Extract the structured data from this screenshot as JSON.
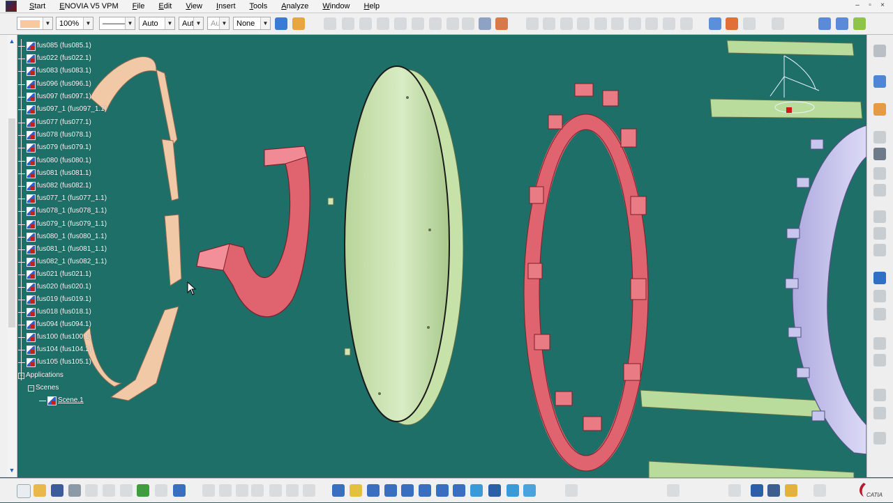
{
  "menubar": {
    "items": [
      {
        "key": "start",
        "label": "Start"
      },
      {
        "key": "enovia",
        "label": "ENOVIA V5 VPM"
      },
      {
        "key": "file",
        "label": "File"
      },
      {
        "key": "edit",
        "label": "Edit"
      },
      {
        "key": "view",
        "label": "View"
      },
      {
        "key": "insert",
        "label": "Insert"
      },
      {
        "key": "tools",
        "label": "Tools"
      },
      {
        "key": "analyze",
        "label": "Analyze"
      },
      {
        "key": "window",
        "label": "Window"
      },
      {
        "key": "help",
        "label": "Help"
      }
    ],
    "window_controls": {
      "minimize": "–",
      "restore": "▫",
      "close": "×"
    }
  },
  "toolbar": {
    "fill_color_combo": "",
    "transparency_combo": "100%",
    "line_type_combo": "———",
    "line_thickness_combo": "Auto",
    "point_symbol_combo": "Aut",
    "layer_combo_disabled": "Aut",
    "layer_combo": "None"
  },
  "tree": {
    "nodes": [
      "fus085 (fus085.1)",
      "fus022 (fus022.1)",
      "fus083 (fus083.1)",
      "fus096 (fus096.1)",
      "fus097 (fus097.1)",
      "fus097_1 (fus097_1.1)",
      "fus077 (fus077.1)",
      "fus078 (fus078.1)",
      "fus079 (fus079.1)",
      "fus080 (fus080.1)",
      "fus081 (fus081.1)",
      "fus082 (fus082.1)",
      "fus077_1 (fus077_1.1)",
      "fus078_1 (fus078_1.1)",
      "fus079_1 (fus079_1.1)",
      "fus080_1 (fus080_1.1)",
      "fus081_1 (fus081_1.1)",
      "fus082_1 (fus082_1.1)",
      "fus021 (fus021.1)",
      "fus020 (fus020.1)",
      "fus019 (fus019.1)",
      "fus018 (fus018.1)",
      "fus094 (fus094.1)",
      "fus100 (fus100.1)",
      "fus104 (fus104.1)",
      "fus105 (fus105.1)"
    ],
    "applications_label": "Applications",
    "scenes_label": "Scenes",
    "scene_label": "Scene.1"
  },
  "icons": {
    "app_logo": "catia-logo-icon",
    "compass": "compass-icon",
    "brand": "3ds-catia-icon"
  },
  "brand_text": "CATIA",
  "colors": {
    "background": "#1e6f68",
    "frame_ring": "#f2c9a6",
    "hook_part": "#e06470",
    "disc_part": "#cfe6b3",
    "lug_ring": "#e06470",
    "rail_part": "#b9dc9c",
    "gear_ring": "#c9c6ee"
  }
}
